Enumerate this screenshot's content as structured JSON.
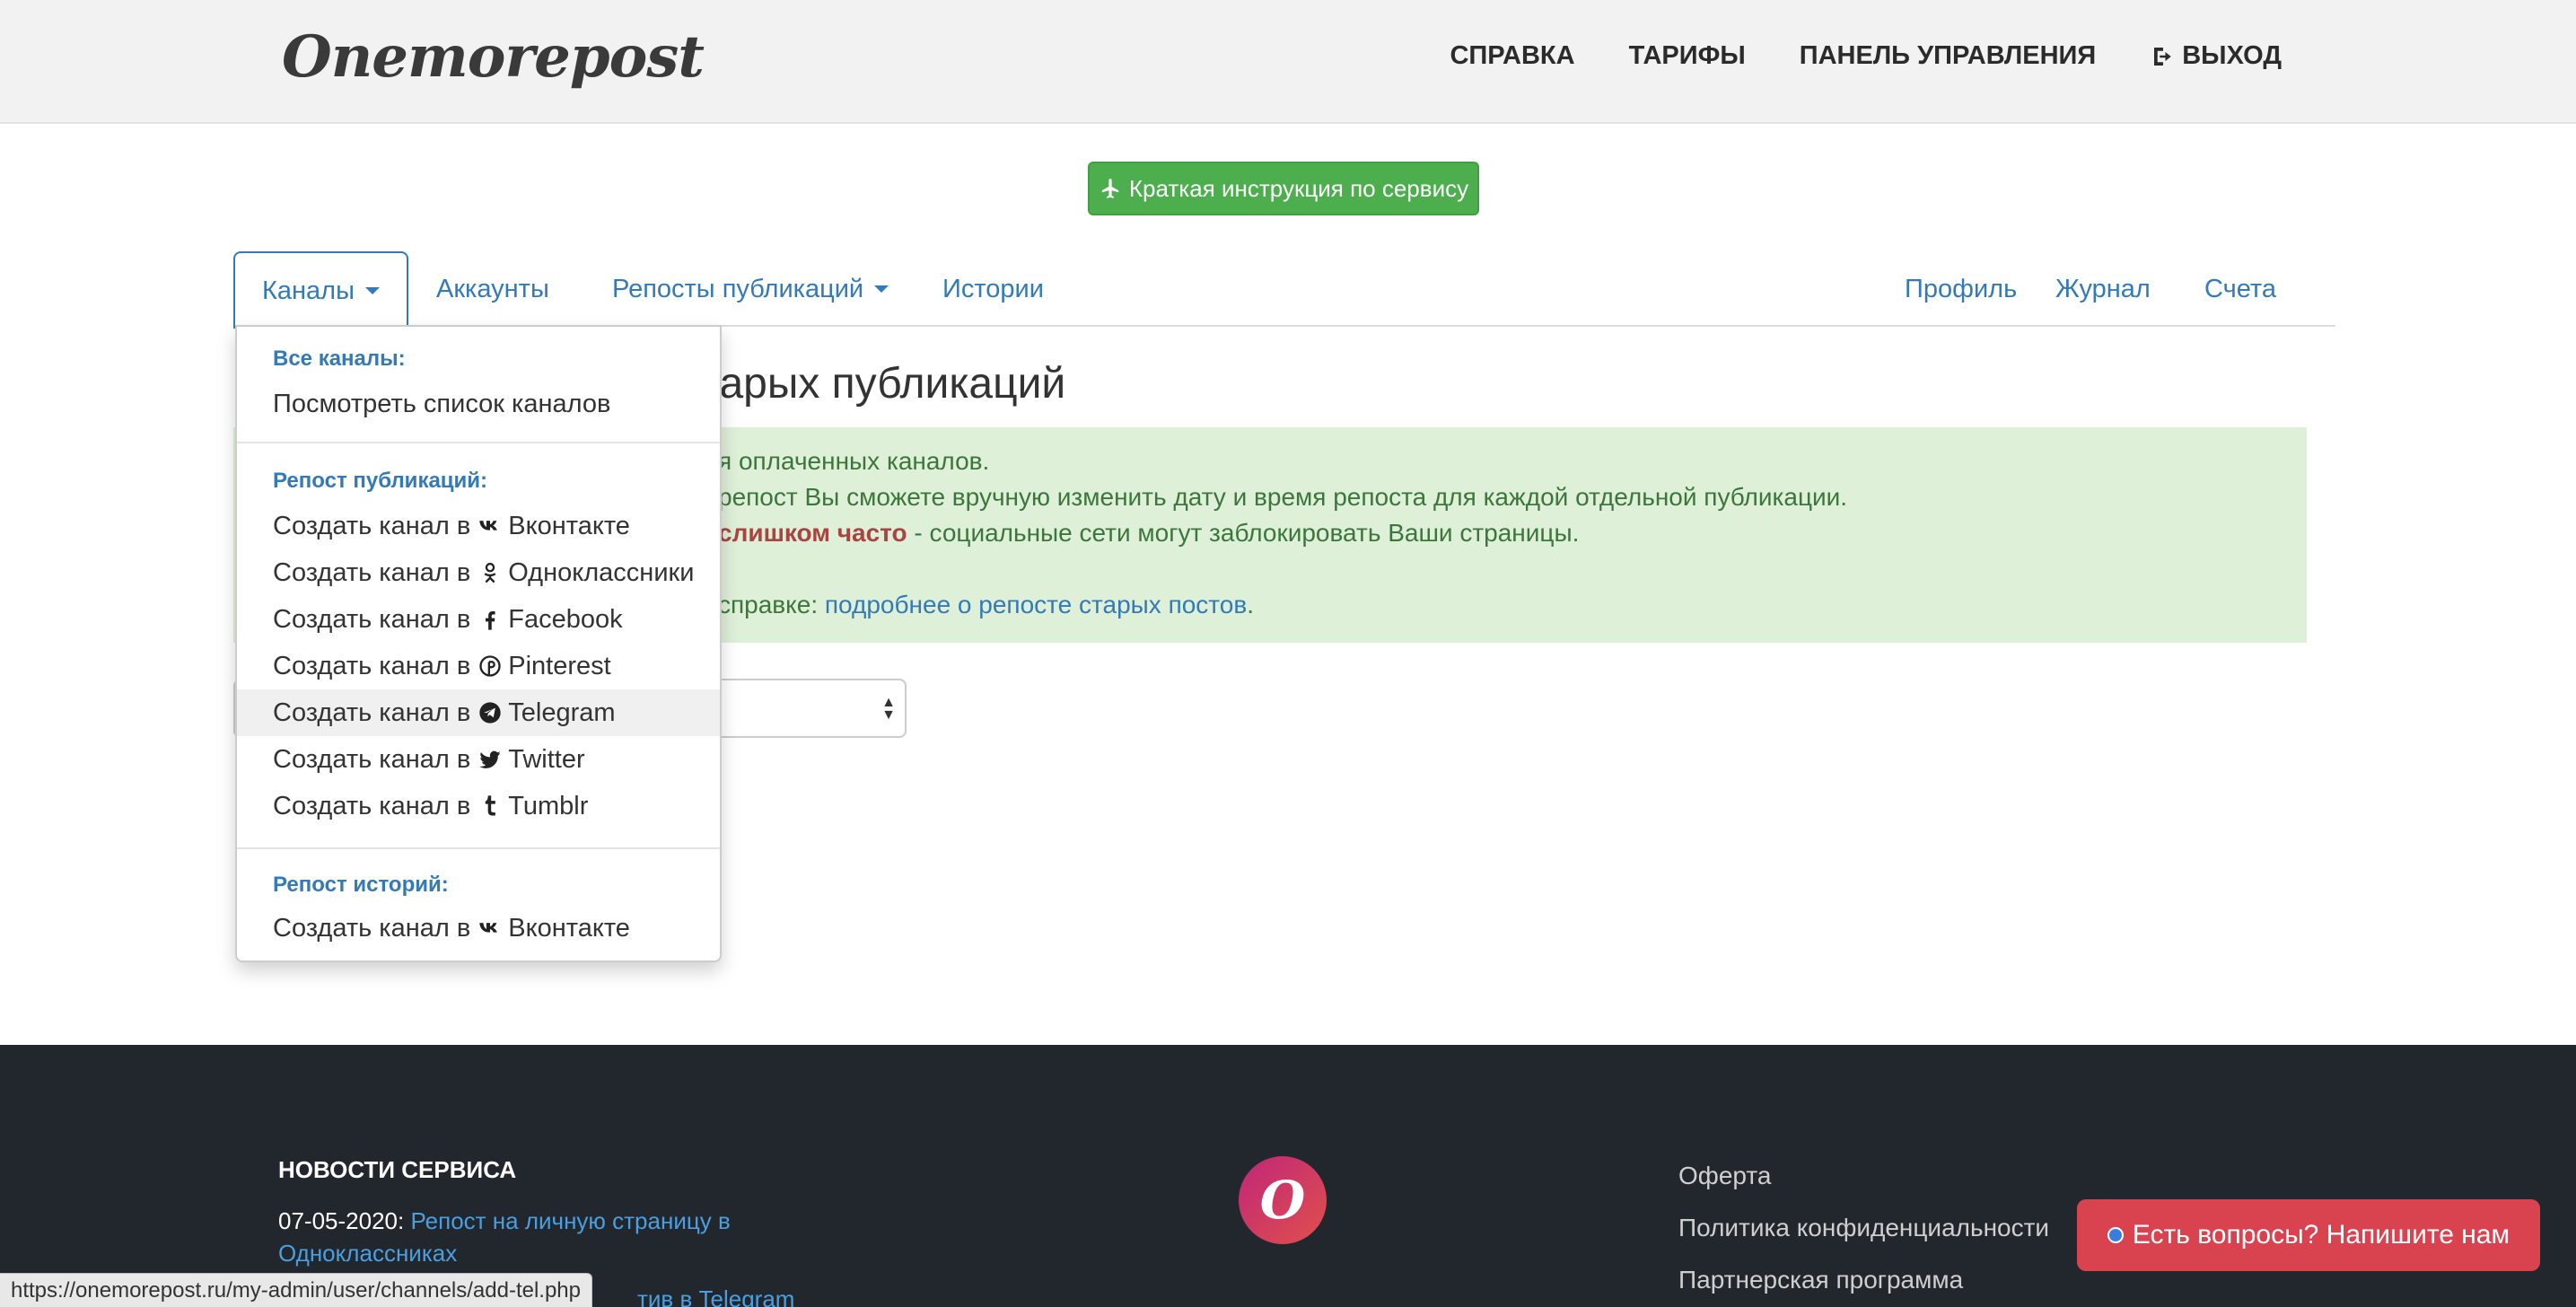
{
  "header": {
    "logo": "Onemorepost",
    "nav": [
      {
        "label": "СПРАВКА",
        "icon": ""
      },
      {
        "label": "ТАРИФЫ",
        "icon": ""
      },
      {
        "label": "ПАНЕЛЬ УПРАВЛЕНИЯ",
        "icon": ""
      },
      {
        "label": "ВЫХОД",
        "icon": "sign-out-icon"
      }
    ]
  },
  "instruction_button": {
    "label": "Краткая инструкция по сервису",
    "icon": "plane-icon",
    "color": "#4cae4c"
  },
  "tabs": {
    "channels": "Каналы",
    "accounts": "Аккаунты",
    "reposts": "Репосты публикаций",
    "stories": "Истории",
    "profile": "Профиль",
    "journal": "Журнал",
    "invoices": "Счета"
  },
  "dropdown": {
    "header_all": "Все каналы:",
    "view_list": "Посмотреть список каналов",
    "header_repost": "Репост публикаций:",
    "create_prefix": "Создать канал в",
    "networks": {
      "vk": "Вконтакте",
      "ok": "Одноклассники",
      "fb": "Facebook",
      "pinterest": "Pinterest",
      "telegram": "Telegram",
      "twitter": "Twitter",
      "tumblr": "Tumblr"
    },
    "header_stories": "Репост историй:",
    "stories_vk": "Вконтакте"
  },
  "main": {
    "title_visible": "тарых публикаций",
    "alert": {
      "line1": "я оплаченных каналов.",
      "line2": "репост Вы сможете вручную изменить дату и время репоста для каждой отдельной публикации.",
      "line3_warn": "слишком часто",
      "line3_rest": " - социальные сети могут заблокировать Ваши страницы.",
      "line4_prefix": "справке: ",
      "line4_link": "подробнее о репосте старых постов",
      "line4_suffix": "."
    }
  },
  "footer": {
    "news_title": "НОВОСТИ СЕРВИСА",
    "news_date": "07-05-2020: ",
    "news_link": "Репост на личную страницу в Одноклассниках",
    "news2_partial": "тив в Telegram",
    "logo_letter": "O",
    "links": [
      "Оферта",
      "Политика конфиденциальности",
      "Партнерская программа"
    ]
  },
  "chat_button": {
    "label": "Есть вопросы? Напишите нам",
    "color": "#d9434f"
  },
  "status_url": "https://onemorepost.ru/my-admin/user/channels/add-tel.php",
  "colors": {
    "link": "#337ab7",
    "alert_bg": "#dff0d8",
    "footer_bg": "#22262d"
  }
}
